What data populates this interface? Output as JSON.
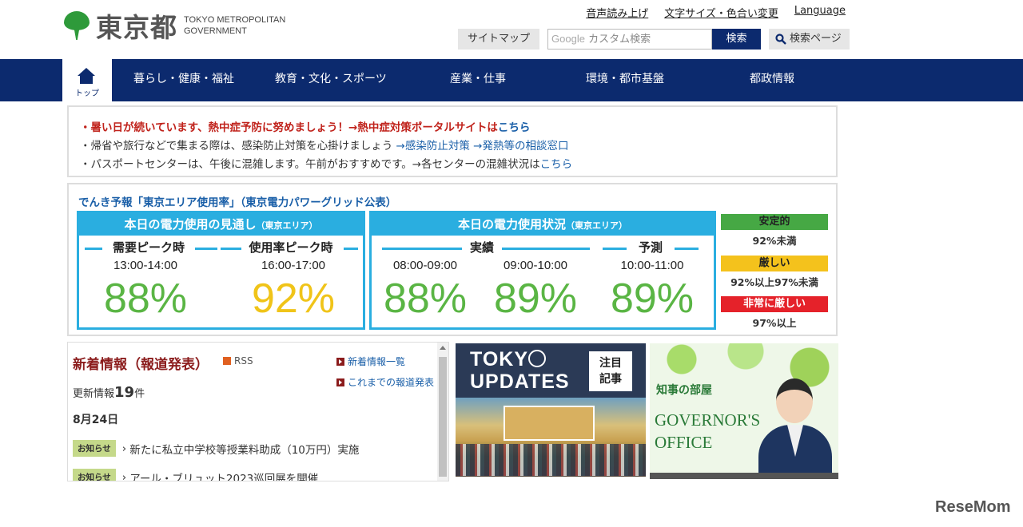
{
  "header": {
    "logo_jp": "東京都",
    "logo_en_line1": "TOKYO METROPOLITAN",
    "logo_en_line2": "GOVERNMENT",
    "util_links": [
      "音声読み上げ",
      "文字サイズ・色合い変更",
      "Language"
    ],
    "sitemap": "サイトマップ",
    "search_placeholder_google": "Google",
    "search_placeholder": "カスタム検索",
    "search_button": "検索",
    "search_page": "検索ページ"
  },
  "nav": {
    "home_label": "トップ",
    "items": [
      "暮らし・健康・福祉",
      "教育・文化・スポーツ",
      "産業・仕事",
      "環境・都市基盤",
      "都政情報"
    ]
  },
  "alert": {
    "line1": "・暑い日が続いています、熱中症予防に努めましょう！→熱中症対策ポータルサイトは",
    "line1_link": "こちら",
    "line2_prefix": "・帰省や旅行などで集まる際は、感染防止対策を心掛けましょう ",
    "line2_link1": "→感染防止対策",
    "line2_link2": "→発熱等の相談窓口",
    "line3_prefix": "・パスポートセンターは、午後に混雑します。午前がおすすめです。→各センターの混雑状況は",
    "line3_link": "こちら"
  },
  "power": {
    "title": "でんき予報「東京エリア使用率」（東京電力パワーグリッド公表）",
    "forecast_head": "本日の電力使用の見通し",
    "area": "（東京エリア）",
    "peak_label": "需要ピーク時",
    "peak_time": "13:00-14:00",
    "peak_value": "88%",
    "rate_peak_label": "使用率ピーク時",
    "rate_peak_time": "16:00-17:00",
    "rate_peak_value": "92%",
    "status_head": "本日の電力使用状況",
    "actual_label": "実績",
    "forecast_label": "予測",
    "t1": "08:00-09:00",
    "v1": "88%",
    "t2": "09:00-10:00",
    "v2": "89%",
    "t3": "10:00-11:00",
    "v3": "89%",
    "legend": [
      {
        "label": "安定的",
        "range": "92%未満",
        "color": "#46a844"
      },
      {
        "label": "厳しい",
        "range": "92%以上97%未満",
        "color": "#f4c21c"
      },
      {
        "label": "非常に厳しい",
        "range": "97%以上",
        "color": "#e5222a"
      }
    ],
    "green": "#5ab544",
    "yellow": "#f0c419"
  },
  "news": {
    "title": "新着情報（報道発表）",
    "rss": "RSS",
    "link_list": "新着情報一覧",
    "link_past": "これまでの報道発表",
    "update_prefix": "更新情報",
    "update_count": "19",
    "update_suffix": "件",
    "date": "8月24日",
    "items": [
      {
        "badge": "お知らせ",
        "text": "新たに私立中学校等授業料助成（10万円）実施"
      },
      {
        "badge": "お知らせ",
        "text": "アール・ブリュット2023巡回展を開催"
      }
    ]
  },
  "banners": {
    "tokyo_updates_1": "TOKY",
    "tokyo_updates_2": "UPDATES",
    "featured_1": "注目",
    "featured_2": "記事",
    "governor_jp": "知事の部屋",
    "governor_en_1": "GOVERNOR'S",
    "governor_en_2": "OFFICE"
  },
  "watermark": "ReseMom"
}
